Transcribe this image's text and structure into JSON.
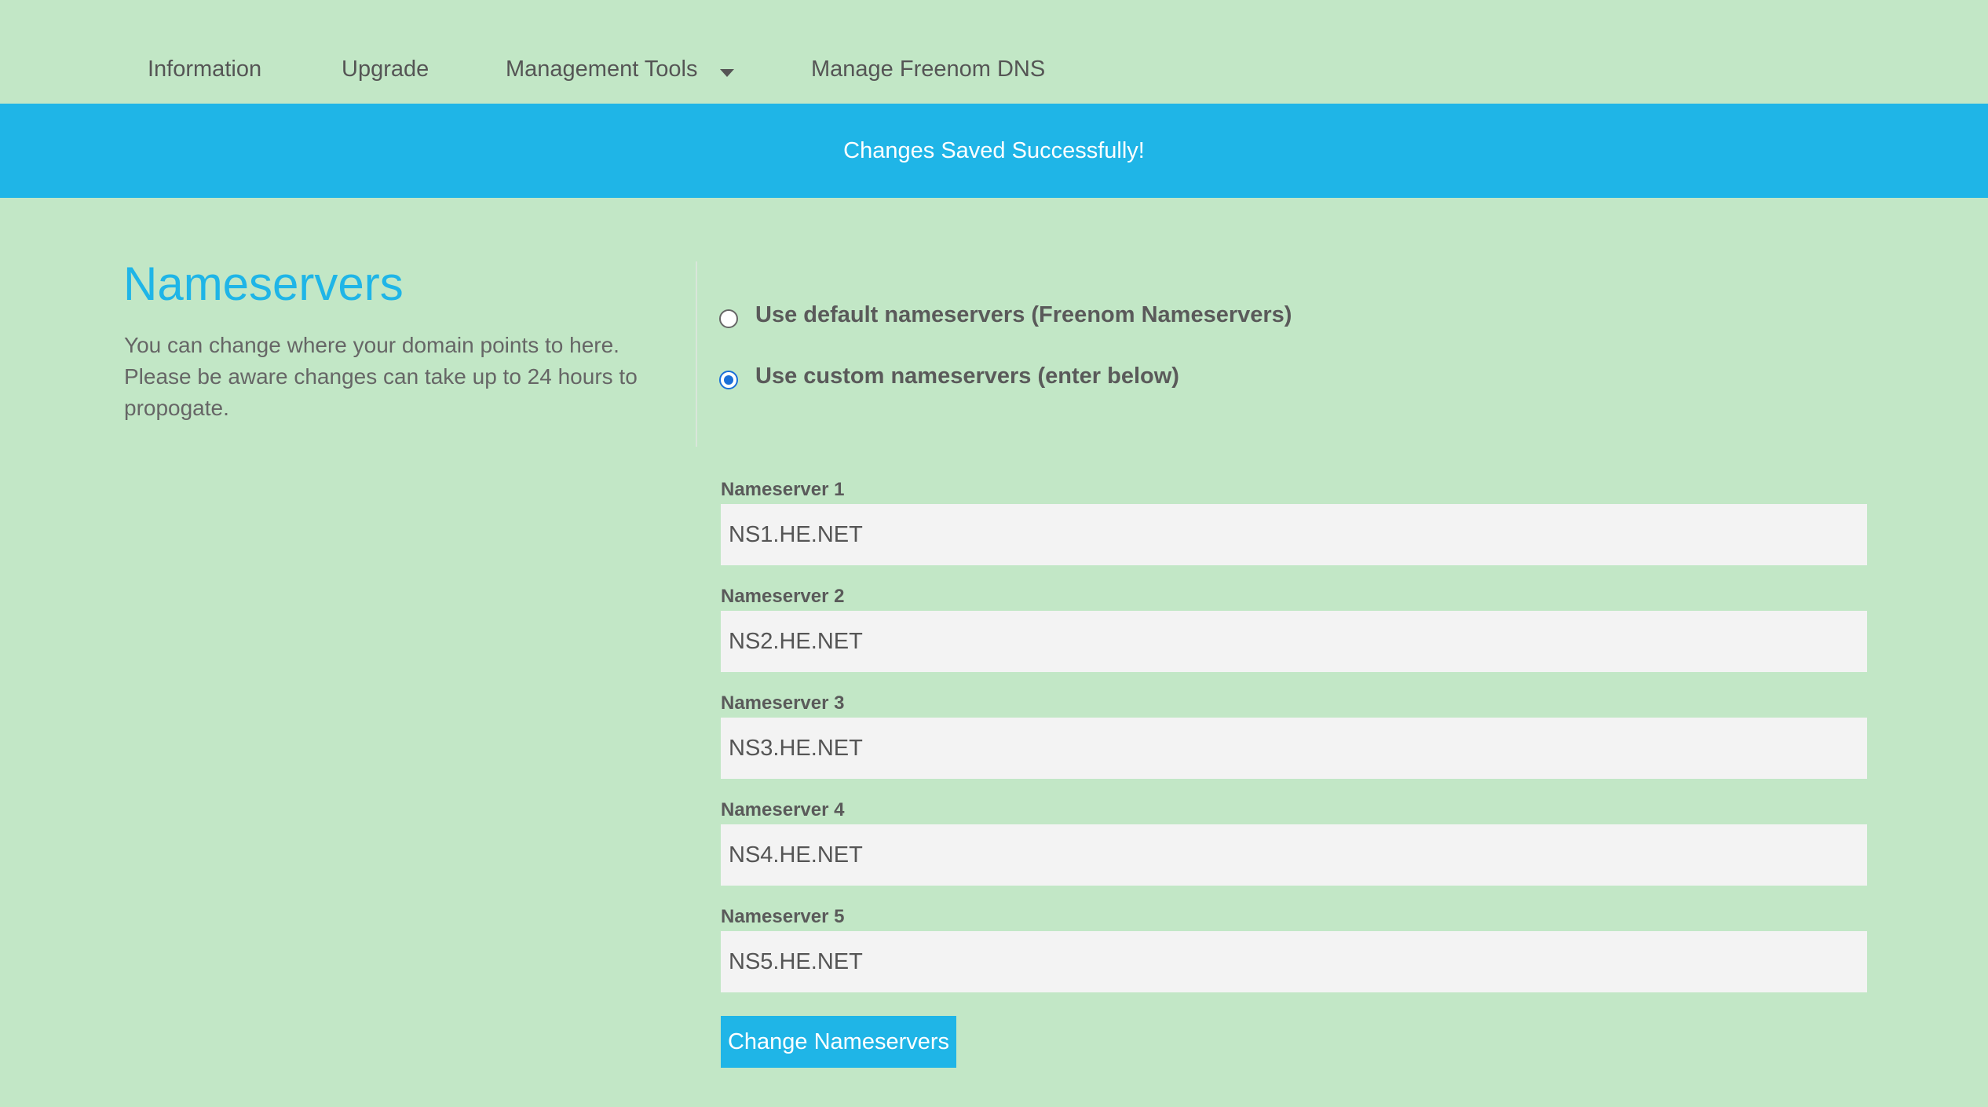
{
  "nav": {
    "items": [
      {
        "label": "Information"
      },
      {
        "label": "Upgrade"
      },
      {
        "label": "Management Tools"
      },
      {
        "label": "Manage Freenom DNS"
      }
    ]
  },
  "banner": {
    "message": "Changes Saved Successfully!"
  },
  "section": {
    "title": "Nameservers",
    "description": "You can change where your domain points to here. Please be aware changes can take up to 24 hours to propogate."
  },
  "options": {
    "default_label": "Use default nameservers (Freenom Nameservers)",
    "custom_label": "Use custom nameservers (enter below)",
    "selected": "custom"
  },
  "nameservers": [
    {
      "label": "Nameserver 1",
      "value": "NS1.HE.NET"
    },
    {
      "label": "Nameserver 2",
      "value": "NS2.HE.NET"
    },
    {
      "label": "Nameserver 3",
      "value": "NS3.HE.NET"
    },
    {
      "label": "Nameserver 4",
      "value": "NS4.HE.NET"
    },
    {
      "label": "Nameserver 5",
      "value": "NS5.HE.NET"
    }
  ],
  "submit": {
    "label": "Change Nameservers"
  },
  "colors": {
    "background": "#c2e7c6",
    "accent": "#1fb5e7",
    "radio_selected": "#1a6fd8"
  }
}
